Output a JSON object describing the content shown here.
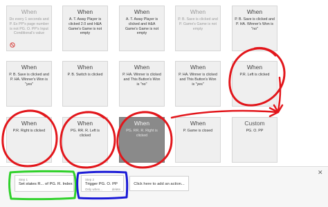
{
  "cards": [
    {
      "title": "When",
      "desc": "Do every 1 seconds and P. Ex PP's page number is not PG. O. PP's Input Conditional's value",
      "disabled": true
    },
    {
      "title": "When",
      "desc": "A. T. Away Player is clicked 2.0 and H&A Game's Game is not empty"
    },
    {
      "title": "When",
      "desc": "A. T. Away Player is clicked and H&A Game's Game is not empty"
    },
    {
      "title": "When",
      "desc": "P. B. Save is clicked and P. Game's Game is not empty",
      "disabled": true
    },
    {
      "title": "When",
      "desc": "P. B. Save is clicked and P. HA. Winner's Won is \"no\""
    },
    {
      "title": "When",
      "desc": "P. B. Save is clicked and P. HA. Winner's Won is \"yes\""
    },
    {
      "title": "When",
      "desc": "P. B. Switch is clicked"
    },
    {
      "title": "When",
      "desc": "P. HA. Winner is clicked and This Button's Won is \"no\""
    },
    {
      "title": "When",
      "desc": "P. HA. Winner is clicked and This Button's Won is \"yes\""
    },
    {
      "title": "When",
      "desc": "P.R. Left is clicked"
    },
    {
      "title": "When",
      "desc": "P.R. Right is clicked"
    },
    {
      "title": "When",
      "desc": "PG. RR. R. Left is clicked"
    },
    {
      "title": "When",
      "desc": "PG. RR. R. Right is clicked",
      "selected": true
    },
    {
      "title": "When",
      "desc": "P. Game is closed"
    },
    {
      "title": "Custom",
      "desc": "PG. O. PP"
    }
  ],
  "steps": [
    {
      "label": "Step 1",
      "text": "Set states R... of PG. R. Index"
    },
    {
      "label": "Step 2",
      "text": "Trigger PG. O. PP",
      "sub": "Only when...",
      "delete": "delete"
    }
  ],
  "add_action_label": "Click here to add an action...",
  "close_label": "✕",
  "colors": {
    "annotation_red": "#e2161b",
    "annotation_green": "#2fd12a",
    "annotation_blue": "#1a1ad6",
    "card_bg": "#efefef",
    "selected_bg": "#8a8a8a"
  }
}
